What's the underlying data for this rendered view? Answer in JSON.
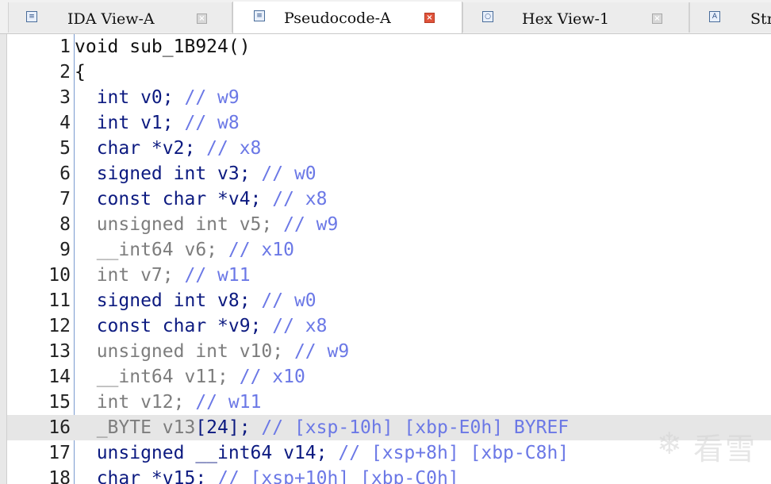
{
  "tabs": [
    {
      "label": "IDA View-A",
      "icon": "ida-view-icon",
      "icon_glyph": "≡",
      "active": false
    },
    {
      "label": "Pseudocode-A",
      "icon": "pseudocode-icon",
      "icon_glyph": "≡",
      "active": true
    },
    {
      "label": "Hex View-1",
      "icon": "hex-view-icon",
      "icon_glyph": "○",
      "active": false
    },
    {
      "label": "Str",
      "icon": "strings-icon",
      "icon_glyph": "A",
      "active": false
    }
  ],
  "close_glyph": "×",
  "lines": [
    {
      "n": "1",
      "parts": [
        {
          "t": "void sub_1B924()",
          "c": ""
        }
      ]
    },
    {
      "n": "2",
      "parts": [
        {
          "t": "{",
          "c": ""
        }
      ]
    },
    {
      "n": "3",
      "parts": [
        {
          "t": "  int v0; ",
          "c": "kw-dark"
        },
        {
          "t": "// w9",
          "c": "cm"
        }
      ]
    },
    {
      "n": "4",
      "parts": [
        {
          "t": "  int v1; ",
          "c": "kw-dark"
        },
        {
          "t": "// w8",
          "c": "cm"
        }
      ]
    },
    {
      "n": "5",
      "parts": [
        {
          "t": "  char *v2; ",
          "c": "kw-dark"
        },
        {
          "t": "// x8",
          "c": "cm"
        }
      ]
    },
    {
      "n": "6",
      "parts": [
        {
          "t": "  signed int v3; ",
          "c": "kw-dark"
        },
        {
          "t": "// w0",
          "c": "cm"
        }
      ]
    },
    {
      "n": "7",
      "parts": [
        {
          "t": "  const char *v4; ",
          "c": "kw-dark"
        },
        {
          "t": "// x8",
          "c": "cm"
        }
      ]
    },
    {
      "n": "8",
      "parts": [
        {
          "t": "  unsigned int v5; ",
          "c": "kw-gray"
        },
        {
          "t": "// w9",
          "c": "cm"
        }
      ]
    },
    {
      "n": "9",
      "parts": [
        {
          "t": "  __int64 v6; ",
          "c": "kw-gray"
        },
        {
          "t": "// x10",
          "c": "cm"
        }
      ]
    },
    {
      "n": "10",
      "parts": [
        {
          "t": "  int v7; ",
          "c": "kw-gray"
        },
        {
          "t": "// w11",
          "c": "cm"
        }
      ]
    },
    {
      "n": "11",
      "parts": [
        {
          "t": "  signed int v8; ",
          "c": "kw-dark"
        },
        {
          "t": "// w0",
          "c": "cm"
        }
      ]
    },
    {
      "n": "12",
      "parts": [
        {
          "t": "  const char *v9; ",
          "c": "kw-dark"
        },
        {
          "t": "// x8",
          "c": "cm"
        }
      ]
    },
    {
      "n": "13",
      "parts": [
        {
          "t": "  unsigned int v10; ",
          "c": "kw-gray"
        },
        {
          "t": "// w9",
          "c": "cm"
        }
      ]
    },
    {
      "n": "14",
      "parts": [
        {
          "t": "  __int64 v11; ",
          "c": "kw-gray"
        },
        {
          "t": "// x10",
          "c": "cm"
        }
      ]
    },
    {
      "n": "15",
      "parts": [
        {
          "t": "  int v12; ",
          "c": "kw-gray"
        },
        {
          "t": "// w11",
          "c": "cm"
        }
      ]
    },
    {
      "n": "16",
      "hl": true,
      "parts": [
        {
          "t": "  _BYTE v13",
          "c": "kw-gray"
        },
        {
          "t": "[24]; ",
          "c": "kw-dark"
        },
        {
          "t": "// [xsp-10h] [xbp-E0h] BYREF",
          "c": "cm"
        }
      ]
    },
    {
      "n": "17",
      "parts": [
        {
          "t": "  unsigned __int64 v14; ",
          "c": "kw-dark"
        },
        {
          "t": "// [xsp+8h] [xbp-C8h]",
          "c": "cm"
        }
      ]
    },
    {
      "n": "18",
      "parts": [
        {
          "t": "  char *v15; ",
          "c": "kw-dark"
        },
        {
          "t": "// [xsp+10h] [xbp-C0h]",
          "c": "cm"
        }
      ]
    }
  ],
  "watermark": "看雪",
  "watermark_icon": "snowflake-icon",
  "colors": {
    "keyword": "#0c1a80",
    "gray": "#7d7d7d",
    "comment": "#6b78e6",
    "highlight": "#e6e6e6",
    "close_active": "#e0533a"
  }
}
